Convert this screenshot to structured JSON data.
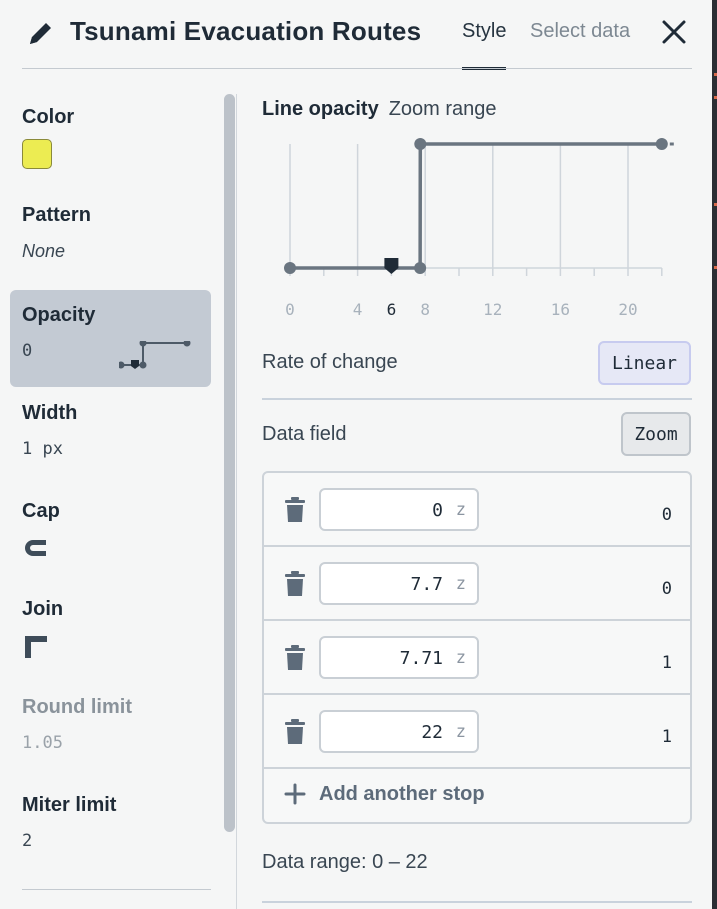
{
  "header": {
    "title": "Tsunami Evacuation Routes",
    "icon": "pencil-icon",
    "tabs": [
      {
        "label": "Style",
        "active": true
      },
      {
        "label": "Select data",
        "active": false
      }
    ],
    "close_icon": "close-icon"
  },
  "sidebar": {
    "items": [
      {
        "label": "Color",
        "swatch": "#ecec52"
      },
      {
        "label": "Pattern",
        "value": "None"
      },
      {
        "label": "Opacity",
        "value": "0",
        "active": true
      },
      {
        "label": "Width",
        "value": "1 px"
      },
      {
        "label": "Cap",
        "icon": "line-cap-icon"
      },
      {
        "label": "Join",
        "icon": "line-join-icon"
      },
      {
        "label": "Round limit",
        "value": "1.05",
        "disabled": true
      },
      {
        "label": "Miter limit",
        "value": "2"
      }
    ]
  },
  "main": {
    "heading": "Line opacity",
    "subheading": "Zoom range",
    "rate_label": "Rate of change",
    "rate_value": "Linear",
    "field_label": "Data field",
    "field_value": "Zoom",
    "stops": [
      {
        "zoom": "0",
        "unit": "z",
        "value": "0"
      },
      {
        "zoom": "7.7",
        "unit": "z",
        "value": "0"
      },
      {
        "zoom": "7.71",
        "unit": "z",
        "value": "1"
      },
      {
        "zoom": "22",
        "unit": "z",
        "value": "1"
      }
    ],
    "add_stop_label": "Add another stop",
    "data_range_label": "Data range: 0 – 22"
  },
  "chart_data": {
    "type": "line",
    "x_ticks": [
      "0",
      "4",
      "6",
      "8",
      "12",
      "16",
      "20"
    ],
    "current_zoom": 6,
    "xlim": [
      0,
      22
    ],
    "ylim": [
      0,
      1
    ],
    "series": [
      {
        "x": [
          0,
          7.7,
          7.71,
          22
        ],
        "y": [
          0,
          0,
          1,
          1
        ]
      }
    ]
  },
  "colors": {
    "line": "#6a7580",
    "accent": "#1f2b37",
    "swatch": "#ecec52"
  }
}
